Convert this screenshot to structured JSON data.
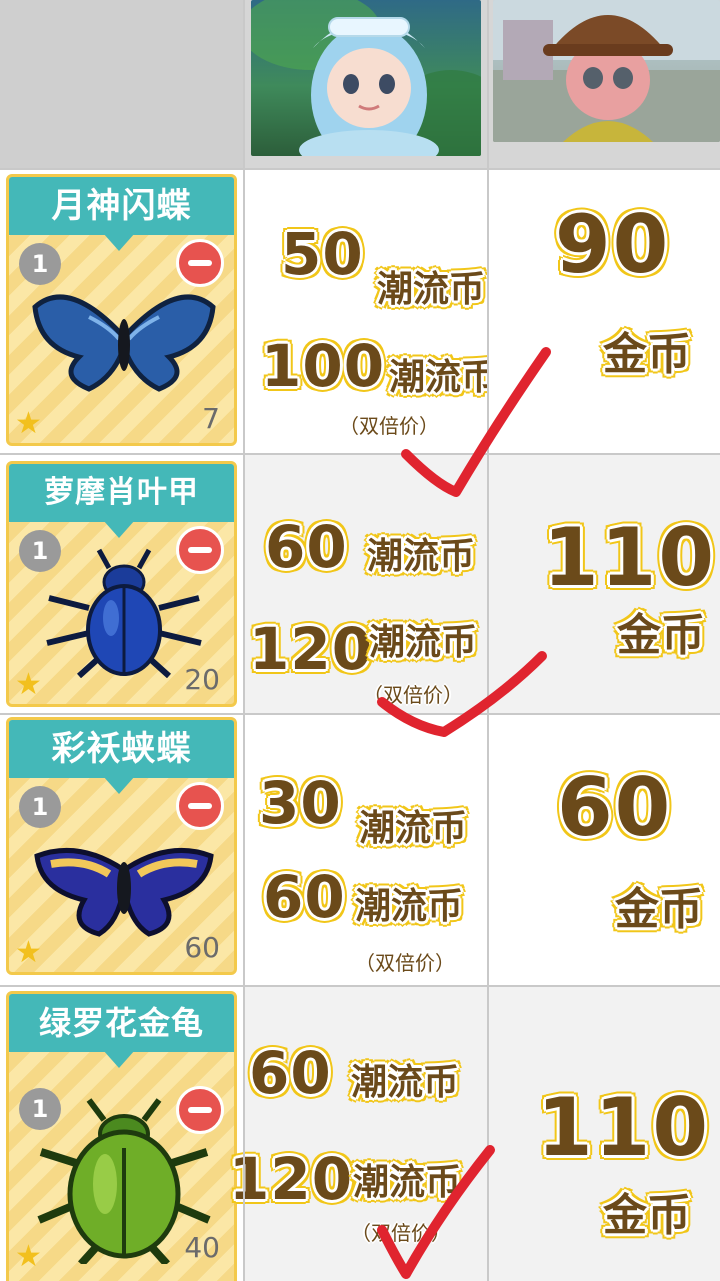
{
  "rows": [
    {
      "name": "月神闪蝶",
      "badge": "1",
      "count": "7",
      "price_normal_value": "50",
      "price_normal_unit": "潮流币",
      "price_double_value": "100",
      "price_double_unit": "潮流币",
      "double_note": "（双倍价）",
      "coin_value": "90",
      "coin_unit": "金币",
      "checked": true
    },
    {
      "name": "萝摩肖叶甲",
      "badge": "1",
      "count": "20",
      "price_normal_value": "60",
      "price_normal_unit": "潮流币",
      "price_double_value": "120",
      "price_double_unit": "潮流币",
      "double_note": "（双倍价）",
      "coin_value": "110",
      "coin_unit": "金币",
      "checked": true
    },
    {
      "name": "彩袄蛱蝶",
      "badge": "1",
      "count": "60",
      "price_normal_value": "30",
      "price_normal_unit": "潮流币",
      "price_double_value": "60",
      "price_double_unit": "潮流币",
      "double_note": "（双倍价）",
      "coin_value": "60",
      "coin_unit": "金币",
      "checked": false
    },
    {
      "name": "绿罗花金龟",
      "badge": "1",
      "count": "40",
      "price_normal_value": "60",
      "price_normal_unit": "潮流币",
      "price_double_value": "120",
      "price_double_unit": "潮流币",
      "double_note": "（双倍价）",
      "coin_value": "110",
      "coin_unit": "金币",
      "checked": true
    }
  ],
  "colors": {
    "price_text": "#6b4a1a",
    "price_outline": "#f1c619",
    "banner": "#44b8b8",
    "check": "#e0242f"
  },
  "icons": {
    "star": "★"
  }
}
